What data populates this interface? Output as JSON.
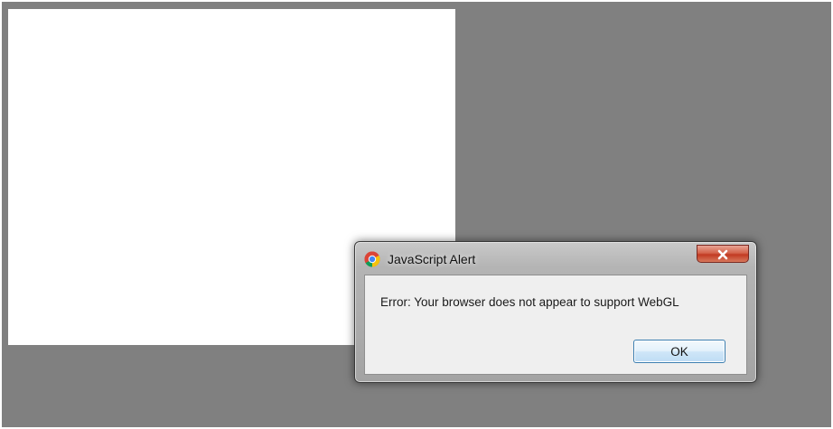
{
  "dialog": {
    "title": "JavaScript Alert",
    "message": "Error: Your browser does not appear to support WebGL",
    "ok_label": "OK",
    "close_icon": "close-icon",
    "app_icon": "chrome-icon"
  },
  "colors": {
    "backdrop": "#808080",
    "canvas": "#ffffff",
    "close_button": "#c94a33",
    "ok_border": "#3c7fb1"
  }
}
